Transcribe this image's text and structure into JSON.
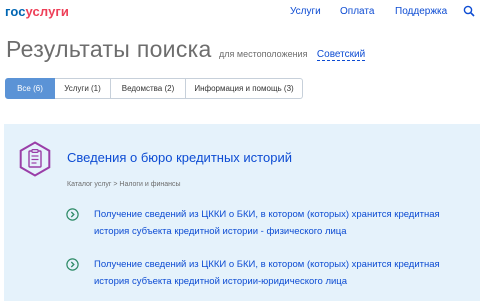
{
  "header": {
    "logo_part1": "гос",
    "logo_part2": "услуги",
    "nav": [
      "Услуги",
      "Оплата",
      "Поддержка"
    ]
  },
  "search_title": {
    "title": "Результаты поиска",
    "location_label": "для местоположения",
    "location_value": "Советский"
  },
  "tabs": [
    {
      "label": "Все (6)",
      "active": true
    },
    {
      "label": "Услуги (1)",
      "active": false
    },
    {
      "label": "Ведомства (2)",
      "active": false
    },
    {
      "label": "Информация и помощь (3)",
      "active": false
    }
  ],
  "result": {
    "title": "Сведения о бюро кредитных историй",
    "breadcrumb": "Каталог услуг > Налоги и финансы",
    "items": [
      "Получение сведений из ЦККИ о БКИ, в котором (которых) хранится кредитная история субъекта кредитной истории - физического лица",
      "Получение сведений из ЦККИ о БКИ, в котором (которых) хранится кредитная история субъекта кредитной истории-юридического лица"
    ]
  },
  "colors": {
    "link": "#0d4cd3",
    "active_tab": "#5b93d6",
    "card_bg": "#e5f2fb",
    "icon_accent": "#9a3ea8",
    "item_icon": "#2e8b67"
  },
  "icons": [
    "search-icon",
    "document-list-icon",
    "chevron-right-icon"
  ]
}
